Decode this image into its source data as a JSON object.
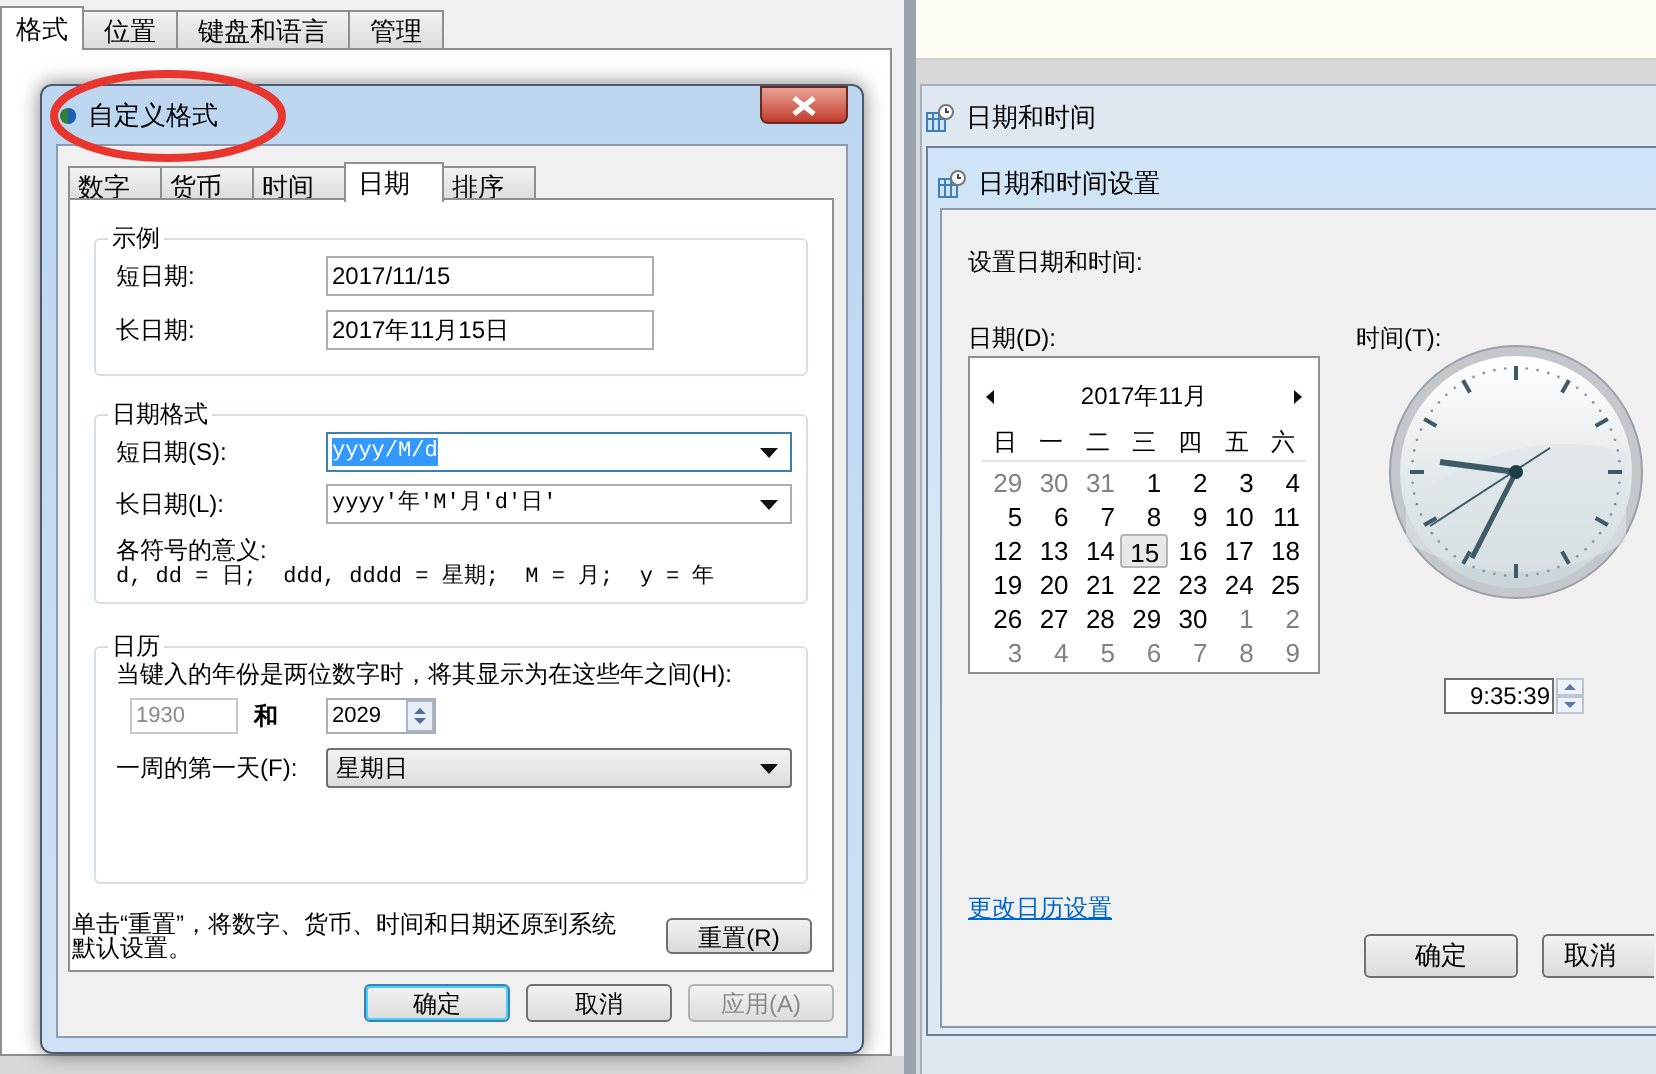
{
  "background_window": {
    "tabs": [
      {
        "label": "格式",
        "selected": true
      },
      {
        "label": "位置",
        "selected": false
      },
      {
        "label": "键盘和语言",
        "selected": false
      },
      {
        "label": "管理",
        "selected": false
      }
    ]
  },
  "custom_format_dialog": {
    "title": "自定义格式",
    "tabs": [
      {
        "label": "数字",
        "selected": false
      },
      {
        "label": "货币",
        "selected": false
      },
      {
        "label": "时间",
        "selected": false
      },
      {
        "label": "日期",
        "selected": true
      },
      {
        "label": "排序",
        "selected": false
      }
    ],
    "example": {
      "title": "示例",
      "rows": [
        {
          "label": "短日期:",
          "value": "2017/11/15"
        },
        {
          "label": "长日期:",
          "value": "2017年11月15日"
        }
      ]
    },
    "date_formats": {
      "title": "日期格式",
      "rows": [
        {
          "label": "短日期(S):",
          "value": "yyyy/M/d",
          "selected": true
        },
        {
          "label": "长日期(L):",
          "value": "yyyy'年'M'月'd'日'",
          "selected": false
        }
      ],
      "legend_title": "各符号的意义:",
      "legend": "d, dd = 日;  ddd, dddd = 星期;  M = 月;  y = 年"
    },
    "calendar": {
      "title": "日历",
      "two_digit_label": "当键入的年份是两位数字时，将其显示为在这些年之间(H):",
      "year_from": {
        "value": "1930",
        "disabled": true
      },
      "and": "和",
      "year_to": {
        "value": "2029",
        "disabled": false
      },
      "first_day_label": "一周的第一天(F):",
      "first_day": "星期日"
    },
    "reset_note": "单击“重置”，将数字、货币、时间和日期还原到系统默认设置。",
    "reset_button": "重置(R)",
    "buttons": [
      {
        "label": "确定",
        "kind": "default"
      },
      {
        "label": "取消",
        "kind": "normal"
      },
      {
        "label": "应用(A)",
        "kind": "disabled"
      }
    ]
  },
  "date_time_window": {
    "title": "日期和时间"
  },
  "date_time_settings_dialog": {
    "title": "日期和时间设置",
    "prompt": "设置日期和时间:",
    "date_label": "日期(D):",
    "calendar": {
      "month": "2017年11月",
      "weekdays": [
        "日",
        "一",
        "二",
        "三",
        "四",
        "五",
        "六"
      ],
      "days": [
        {
          "day": "29",
          "other_month": true,
          "selected": false
        },
        {
          "day": "30",
          "other_month": true,
          "selected": false
        },
        {
          "day": "31",
          "other_month": true,
          "selected": false
        },
        {
          "day": "1",
          "other_month": false,
          "selected": false
        },
        {
          "day": "2",
          "other_month": false,
          "selected": false
        },
        {
          "day": "3",
          "other_month": false,
          "selected": false
        },
        {
          "day": "4",
          "other_month": false,
          "selected": false
        },
        {
          "day": "5",
          "other_month": false,
          "selected": false
        },
        {
          "day": "6",
          "other_month": false,
          "selected": false
        },
        {
          "day": "7",
          "other_month": false,
          "selected": false
        },
        {
          "day": "8",
          "other_month": false,
          "selected": false
        },
        {
          "day": "9",
          "other_month": false,
          "selected": false
        },
        {
          "day": "10",
          "other_month": false,
          "selected": false
        },
        {
          "day": "11",
          "other_month": false,
          "selected": false
        },
        {
          "day": "12",
          "other_month": false,
          "selected": false
        },
        {
          "day": "13",
          "other_month": false,
          "selected": false
        },
        {
          "day": "14",
          "other_month": false,
          "selected": false
        },
        {
          "day": "15",
          "other_month": false,
          "selected": true
        },
        {
          "day": "16",
          "other_month": false,
          "selected": false
        },
        {
          "day": "17",
          "other_month": false,
          "selected": false
        },
        {
          "day": "18",
          "other_month": false,
          "selected": false
        },
        {
          "day": "19",
          "other_month": false,
          "selected": false
        },
        {
          "day": "20",
          "other_month": false,
          "selected": false
        },
        {
          "day": "21",
          "other_month": false,
          "selected": false
        },
        {
          "day": "22",
          "other_month": false,
          "selected": false
        },
        {
          "day": "23",
          "other_month": false,
          "selected": false
        },
        {
          "day": "24",
          "other_month": false,
          "selected": false
        },
        {
          "day": "25",
          "other_month": false,
          "selected": false
        },
        {
          "day": "26",
          "other_month": false,
          "selected": false
        },
        {
          "day": "27",
          "other_month": false,
          "selected": false
        },
        {
          "day": "28",
          "other_month": false,
          "selected": false
        },
        {
          "day": "29",
          "other_month": false,
          "selected": false
        },
        {
          "day": "30",
          "other_month": false,
          "selected": false
        },
        {
          "day": "1",
          "other_month": true,
          "selected": false
        },
        {
          "day": "2",
          "other_month": true,
          "selected": false
        },
        {
          "day": "3",
          "other_month": true,
          "selected": false
        },
        {
          "day": "4",
          "other_month": true,
          "selected": false
        },
        {
          "day": "5",
          "other_month": true,
          "selected": false
        },
        {
          "day": "6",
          "other_month": true,
          "selected": false
        },
        {
          "day": "7",
          "other_month": true,
          "selected": false
        },
        {
          "day": "8",
          "other_month": true,
          "selected": false
        },
        {
          "day": "9",
          "other_month": true,
          "selected": false
        }
      ]
    },
    "time_label": "时间(T):",
    "time": "9:35:39",
    "calendar_link": "更改日历设置",
    "buttons": [
      {
        "label": "确定"
      },
      {
        "label": "取消"
      }
    ]
  }
}
